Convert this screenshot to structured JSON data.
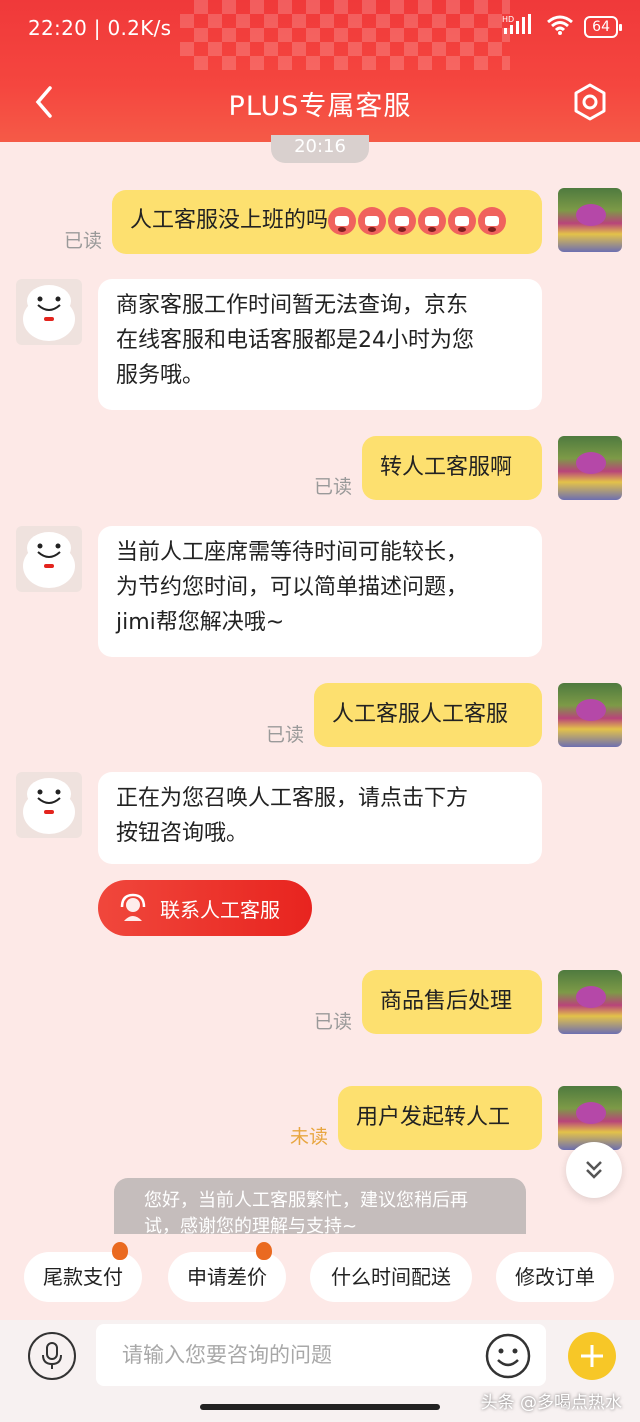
{
  "status": {
    "time_speed": "22:20 | 0.2K/s",
    "network": "HD",
    "battery": "64"
  },
  "header": {
    "title": "PLUS专属客服"
  },
  "chat": {
    "timestamp": "20:16",
    "messages": [
      {
        "from": "user",
        "text": "人工客服没上班的吗",
        "receipt": "已读",
        "emoji_count": 6
      },
      {
        "from": "bot",
        "lines": [
          "商家客服工作时间暂无法查询，京东",
          "在线客服和电话客服都是24小时为您",
          "服务哦。"
        ]
      },
      {
        "from": "user",
        "text": "转人工客服啊",
        "receipt": "已读"
      },
      {
        "from": "bot",
        "lines": [
          "当前人工座席需等待时间可能较长，",
          "为节约您时间，可以简单描述问题，",
          "jimi帮您解决哦~"
        ]
      },
      {
        "from": "user",
        "text": "人工客服人工客服",
        "receipt": "已读"
      },
      {
        "from": "bot",
        "lines": [
          "正在为您召唤人工客服，请点击下方",
          "按钮咨询哦。"
        ]
      },
      {
        "from": "user",
        "text": "商品售后处理",
        "receipt": "已读"
      },
      {
        "from": "user",
        "text": "用户发起转人工",
        "receipt": "未读"
      }
    ],
    "contact_button": "联系人工客服",
    "toast": [
      "您好，当前人工客服繁忙，建议您稍后再",
      "试，感谢您的理解与支持~"
    ]
  },
  "quick_chips": [
    {
      "label": "尾款支付",
      "hot": true
    },
    {
      "label": "申请差价",
      "hot": true
    },
    {
      "label": "什么时间配送",
      "hot": false
    },
    {
      "label": "修改订单",
      "hot": false
    }
  ],
  "input": {
    "placeholder": "请输入您要咨询的问题"
  },
  "watermark": "头条 @多喝点热水",
  "colors": {
    "header": "#f0393a",
    "user_bubble": "#fde06f",
    "accent_plus": "#f7c727",
    "unread": "#e8a640"
  }
}
